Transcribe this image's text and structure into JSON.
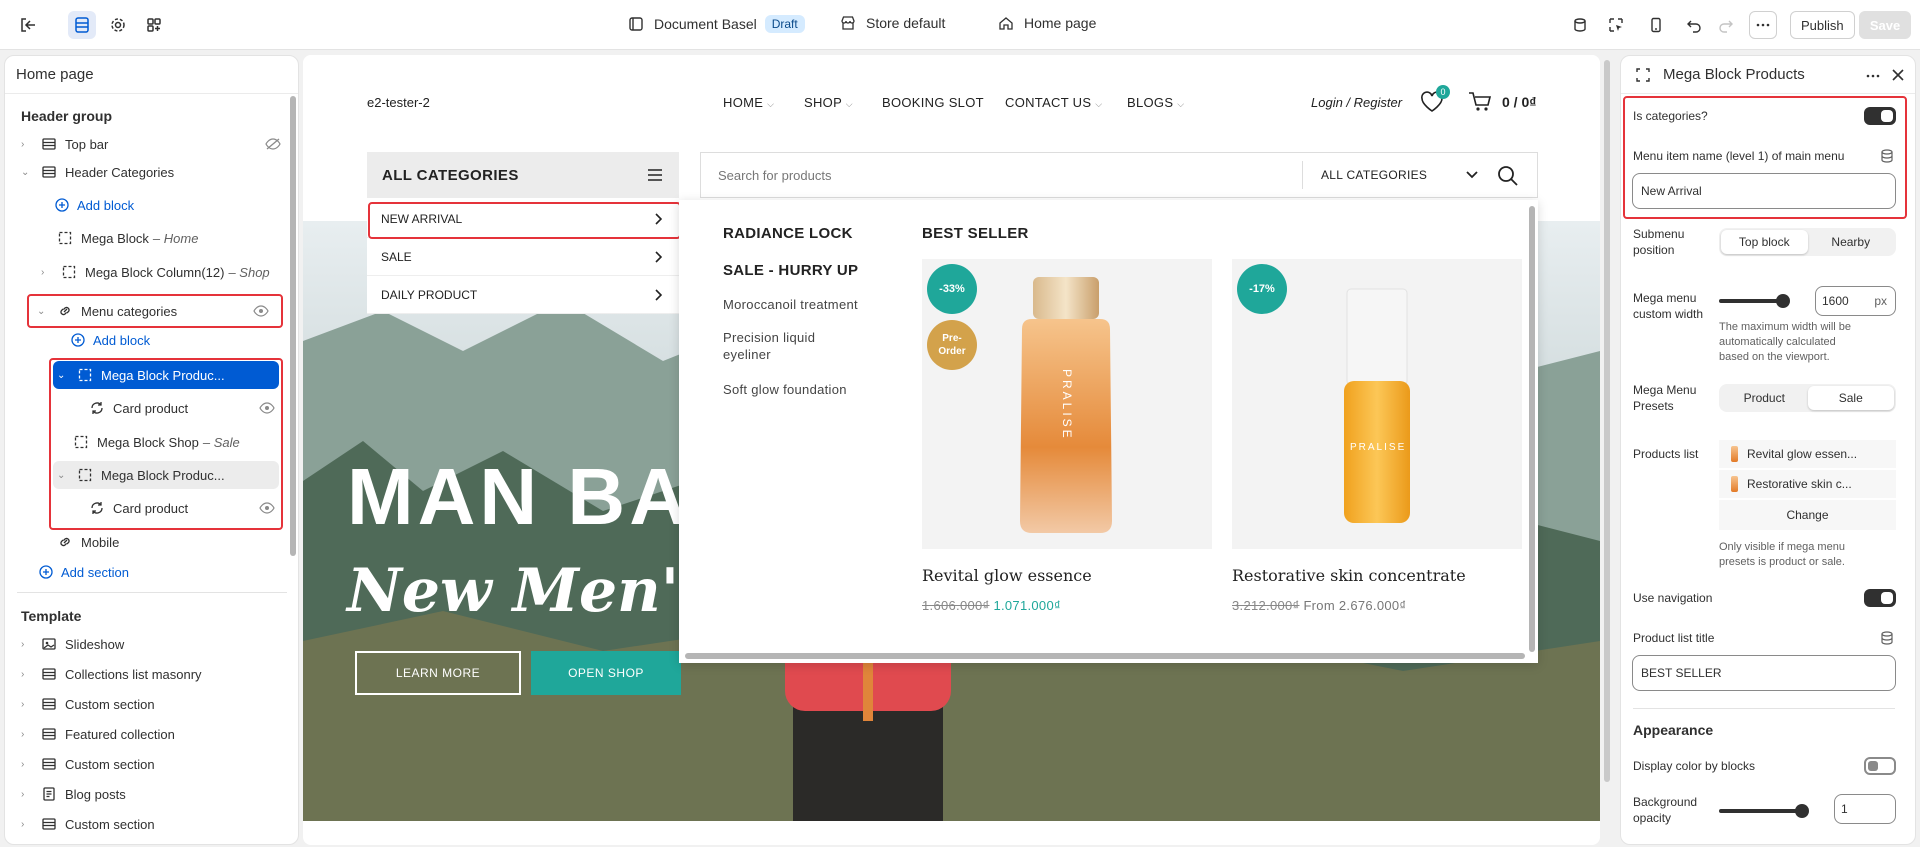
{
  "topbar": {
    "document_name": "Document Basel",
    "draft_label": "Draft",
    "store_name": "Store default",
    "page_name": "Home page",
    "publish_label": "Publish",
    "save_label": "Save"
  },
  "left_panel": {
    "title": "Home page",
    "header_group_label": "Header group",
    "items": [
      {
        "label": "Top bar"
      },
      {
        "label": "Header Categories"
      },
      {
        "label": "Add block"
      },
      {
        "label": "Mega Block",
        "sub": "– Home"
      },
      {
        "label": "Mega Block Column(12)",
        "sub": "– Shop"
      },
      {
        "label": "Menu categories"
      },
      {
        "label": "Add block"
      },
      {
        "label": "Mega Block Produc..."
      },
      {
        "label": "Card product"
      },
      {
        "label": "Mega Block Shop",
        "sub": "– Sale"
      },
      {
        "label": "Mega Block Produc..."
      },
      {
        "label": "Card product"
      },
      {
        "label": "Mobile"
      },
      {
        "label": "Add section"
      }
    ],
    "template_label": "Template",
    "template_items": [
      {
        "label": "Slideshow"
      },
      {
        "label": "Collections list masonry"
      },
      {
        "label": "Custom section"
      },
      {
        "label": "Featured collection"
      },
      {
        "label": "Custom section"
      },
      {
        "label": "Blog posts"
      },
      {
        "label": "Custom section"
      }
    ]
  },
  "preview": {
    "logo": "e2-tester-2",
    "nav": [
      {
        "label": "HOME"
      },
      {
        "label": "SHOP"
      },
      {
        "label": "BOOKING SLOT"
      },
      {
        "label": "CONTACT US"
      },
      {
        "label": "BLOGS"
      }
    ],
    "login": "Login / Register",
    "wishlist_count": "0",
    "cart_total": "0 / 0₫",
    "all_categories_title": "ALL CATEGORIES",
    "search_placeholder": "Search for products",
    "search_category": "ALL CATEGORIES",
    "categories": [
      {
        "label": "NEW ARRIVAL"
      },
      {
        "label": "SALE"
      },
      {
        "label": "DAILY PRODUCT"
      }
    ],
    "mega": {
      "col1_title": "RADIANCE LOCK",
      "col1_subtitle": "SALE - HURRY UP",
      "col1_links": [
        {
          "label": "Moroccanoil treatment"
        },
        {
          "label": "Precision liquid eyeliner"
        },
        {
          "label": "Soft glow foundation"
        }
      ],
      "best_seller_title": "BEST SELLER",
      "products": [
        {
          "name": "Revital glow essence",
          "old_price": "1.606.000₫",
          "price": "1.071.000₫",
          "badge": "-33%",
          "badge2": "Pre-Order",
          "brand": "PRALISE"
        },
        {
          "name": "Restorative skin concentrate",
          "old_price": "3.212.000₫",
          "price": "From 2.676.000₫",
          "badge": "-17%",
          "brand": "PRALISE"
        }
      ]
    },
    "hero": {
      "title": "MAN BA",
      "subtitle": "New Men's C",
      "btn_learn": "LEARN MORE",
      "btn_shop": "OPEN SHOP"
    }
  },
  "right_panel": {
    "title": "Mega Block Products",
    "is_categories_label": "Is categories?",
    "menu_item_label": "Menu item name (level 1) of main menu",
    "menu_item_value": "New Arrival",
    "submenu_position_label": "Submenu position",
    "submenu_options": [
      "Top block",
      "Nearby"
    ],
    "mega_width_label": "Mega menu custom width",
    "mega_width_value": "1600",
    "mega_width_unit": "px",
    "mega_width_help": "The maximum width will be automatically calculated based on the viewport.",
    "presets_label": "Mega Menu Presets",
    "presets_options": [
      "Product",
      "Sale"
    ],
    "products_list_label": "Products list",
    "products_list": [
      {
        "label": "Revital glow essen..."
      },
      {
        "label": "Restorative skin c..."
      }
    ],
    "change_label": "Change",
    "products_help": "Only visible if mega menu presets is product or sale.",
    "use_navigation_label": "Use navigation",
    "product_list_title_label": "Product list title",
    "product_list_title_value": "BEST SELLER",
    "appearance_label": "Appearance",
    "display_color_label": "Display color by blocks",
    "bg_opacity_label": "Background opacity",
    "bg_opacity_value": "1"
  },
  "colors": {
    "accent_blue": "#005bd3",
    "highlight_red": "#e5333a",
    "teal": "#1fa79a",
    "gold": "#d3a24b"
  }
}
